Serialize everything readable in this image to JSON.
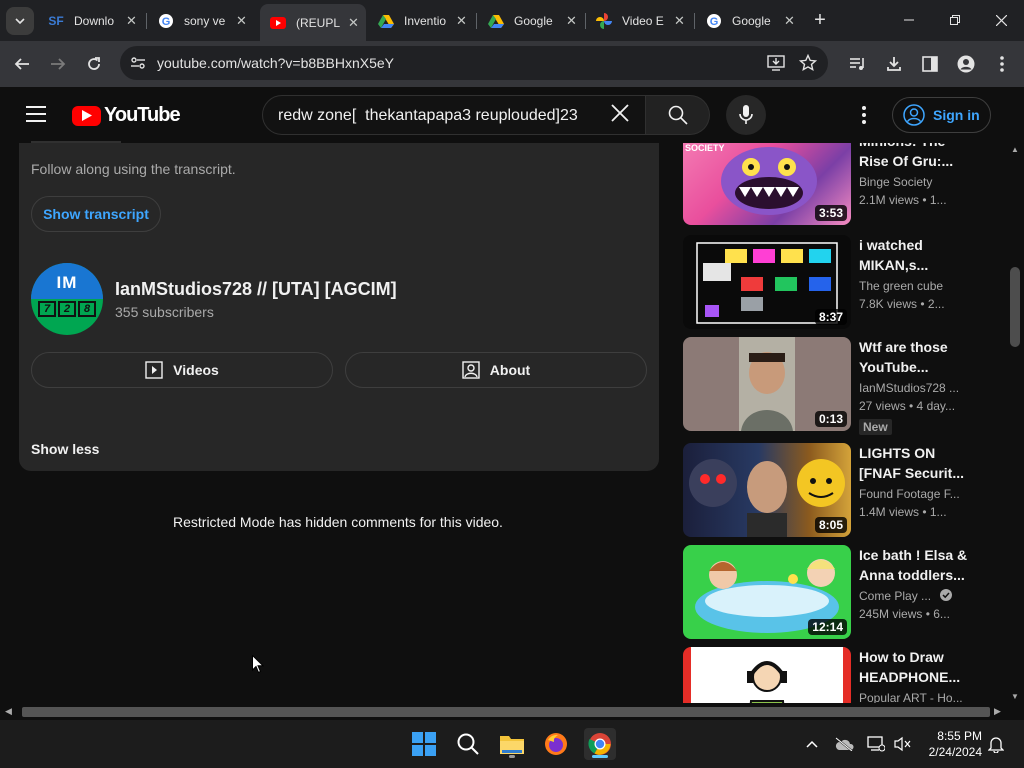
{
  "browser": {
    "tabs": [
      {
        "title": "Downlo",
        "icon": "sourceforge-icon"
      },
      {
        "title": "sony ve",
        "icon": "google-icon"
      },
      {
        "title": "(REUPL",
        "icon": "youtube-icon",
        "active": true
      },
      {
        "title": "Inventio",
        "icon": "google-drive-icon"
      },
      {
        "title": "Google",
        "icon": "google-drive-icon"
      },
      {
        "title": "Video E",
        "icon": "google-photos-icon"
      },
      {
        "title": "Google",
        "icon": "google-icon"
      }
    ],
    "url": "youtube.com/watch?v=b8BBHxnX5eY"
  },
  "youtube": {
    "logo_text": "YouTube",
    "search_query": "redw zone[  thekantapapa3 reuplouded]23",
    "sign_in_label": "Sign in"
  },
  "description": {
    "transcript_hint": "Follow along using the transcript.",
    "show_transcript_label": "Show transcript",
    "channel_name": "IanMStudios728 // [UTA] [AGCIM]",
    "subscribers": "355 subscribers",
    "avatar_text_top": "IM",
    "avatar_digits": [
      "7",
      "2",
      "8"
    ],
    "videos_label": "Videos",
    "about_label": "About",
    "show_less_label": "Show less"
  },
  "comments_notice": "Restricted Mode has hidden comments for this video.",
  "related": [
    {
      "title_line1": "Minions: The",
      "title_line2": "Rise Of Gru:...",
      "channel": "Binge Society",
      "meta": "2.1M views  •  1...",
      "duration": "3:53",
      "thumb_label": "SOCIETY"
    },
    {
      "title_line1": "i watched",
      "title_line2": "MIKAN,s...",
      "channel": "The green cube",
      "meta": "7.8K views  •  2...",
      "duration": "8:37"
    },
    {
      "title_line1": "Wtf are those",
      "title_line2": "YouTube...",
      "channel": "IanMStudios728 ...",
      "meta": "27 views  •  4 day...",
      "duration": "0:13",
      "badge": "New"
    },
    {
      "title_line1": "LIGHTS ON",
      "title_line2": "[FNAF Securit...",
      "channel": "Found Footage F...",
      "meta": "1.4M views  •  1...",
      "duration": "8:05"
    },
    {
      "title_line1": "Ice bath ! Elsa &",
      "title_line2": "Anna toddlers...",
      "channel": "Come Play ...",
      "meta": "245M views  •  6...",
      "duration": "12:14",
      "verified": true
    },
    {
      "title_line1": "How to Draw",
      "title_line2": "HEADPHONE...",
      "channel": "Popular ART - Ho...",
      "meta": "",
      "duration": ""
    }
  ],
  "taskbar": {
    "time": "8:55 PM",
    "date": "2/24/2024"
  }
}
